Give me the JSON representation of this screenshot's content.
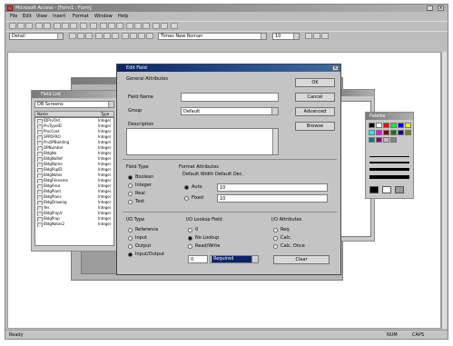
{
  "app": {
    "title": "Microsoft Access - [Form1 : Form]",
    "menu": [
      "File",
      "Edit",
      "View",
      "Insert",
      "Format",
      "Window",
      "Help"
    ],
    "font_name": "Times New Roman",
    "font_size": "10",
    "object_box": "Detail"
  },
  "field_list": {
    "title": "Field List",
    "combo": "DB Screens",
    "col1": "Name",
    "col2": "Type",
    "rows": [
      [
        "IDPrvOrd",
        "Integer"
      ],
      [
        "PrvTypeID",
        "Integer"
      ],
      [
        "ProcCost",
        "Integer"
      ],
      [
        "SPPDFRO",
        "Integer"
      ],
      [
        "PrvDPBuilding",
        "Integer"
      ],
      [
        "DPNumber",
        "Integer"
      ],
      [
        "BldgNo",
        "Integer"
      ],
      [
        "BldgNoRef",
        "Integer"
      ],
      [
        "BldgName",
        "Integer"
      ],
      [
        "BldgPopID",
        "Integer"
      ],
      [
        "BldgNotes",
        "Integer"
      ],
      [
        "BldgFilename",
        "Integer"
      ],
      [
        "BldgArea",
        "Integer"
      ],
      [
        "BldgPlant",
        "Integer"
      ],
      [
        "BldgPlans",
        "Integer"
      ],
      [
        "BldgDrawing",
        "Integer"
      ],
      [
        "Yes",
        "Integer"
      ],
      [
        "BldgPropV",
        "Integer"
      ],
      [
        "BldgProp",
        "Integer"
      ],
      [
        "BldgNotes2",
        "Integer"
      ]
    ]
  },
  "dialog": {
    "title": "Edit Field",
    "general_group": "General Attributes",
    "field_name_label": "Field Name",
    "field_name_value": "",
    "group_label": "Group",
    "group_value": "Default",
    "description_label": "Description",
    "buttons": [
      "OK",
      "Cancel",
      "Advanced",
      "Browse"
    ],
    "field_type_group": "Field Type",
    "field_types": [
      "Boolean",
      "Integer",
      "Real",
      "Text"
    ],
    "format_group": "Format Attributes",
    "format_sub": "Default Width  Default Dec.",
    "format_auto": "Auto",
    "format_auto_value": "10",
    "format_fixed": "Fixed",
    "format_fixed_value": "10",
    "io_group": "I/O Type",
    "io_types": [
      "Reference",
      "Input",
      "Output",
      "Input/Output"
    ],
    "lookup_group": "I/O Lookup Field",
    "lookup_items": [
      "0",
      "No Lookup",
      "Read/Write"
    ],
    "lookup_value": "0",
    "lookup_select": "Required",
    "attr_group": "I/O Attributes",
    "attr_items": [
      "Req.",
      "Calc.",
      "Calc. Once"
    ],
    "clear_button": "Clear"
  },
  "palette": {
    "title": "Palette",
    "colors": [
      "#000000",
      "#ffffff",
      "#ff0000",
      "#00ff00",
      "#0000ff",
      "#ffff00",
      "#00ffff",
      "#ff00ff",
      "#800000",
      "#008000",
      "#000080",
      "#808000",
      "#008080",
      "#800080",
      "#c0c0c0",
      "#808080"
    ]
  },
  "status": {
    "text": "Ready",
    "indicators": [
      "NUM",
      "CAPS"
    ]
  }
}
